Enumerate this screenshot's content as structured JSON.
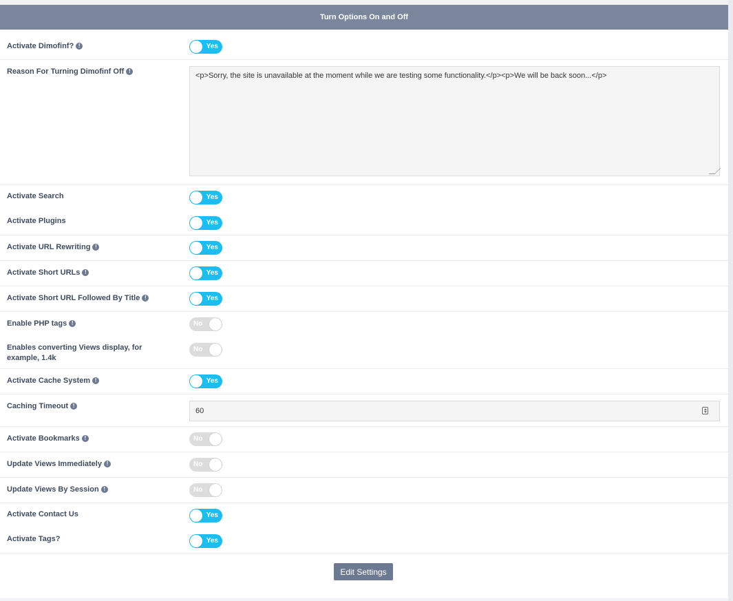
{
  "header": {
    "title": "Turn Options On and Off"
  },
  "settings": {
    "activate_dimofinf": {
      "label": "Activate Dimofinf?",
      "state": "Yes"
    },
    "reason_off": {
      "label": "Reason For Turning Dimofinf Off",
      "value": "<p>Sorry, the site is unavailable at the moment while we are testing some functionality.</p><p>We will be back soon...</p>"
    },
    "activate_search": {
      "label": "Activate Search",
      "state": "Yes"
    },
    "activate_plugins": {
      "label": "Activate Plugins",
      "state": "Yes"
    },
    "url_rewriting": {
      "label": "Activate URL Rewriting",
      "state": "Yes"
    },
    "short_urls": {
      "label": "Activate Short URLs",
      "state": "Yes"
    },
    "short_url_title": {
      "label": "Activate Short URL Followed By Title",
      "state": "Yes"
    },
    "php_tags": {
      "label": "Enable PHP tags",
      "state": "No"
    },
    "views_display": {
      "label": "Enables converting Views display, for example, 1.4k",
      "state": "No"
    },
    "cache_system": {
      "label": "Activate Cache System",
      "state": "Yes"
    },
    "caching_timeout": {
      "label": "Caching Timeout",
      "value": "60"
    },
    "bookmarks": {
      "label": "Activate Bookmarks",
      "state": "No"
    },
    "views_immediately": {
      "label": "Update Views Immediately",
      "state": "No"
    },
    "views_session": {
      "label": "Update Views By Session",
      "state": "No"
    },
    "contact_us": {
      "label": "Activate Contact Us",
      "state": "Yes"
    },
    "tags": {
      "label": "Activate Tags?",
      "state": "Yes"
    }
  },
  "info_icon": "!",
  "footer": {
    "submit_label": "Edit Settings"
  }
}
